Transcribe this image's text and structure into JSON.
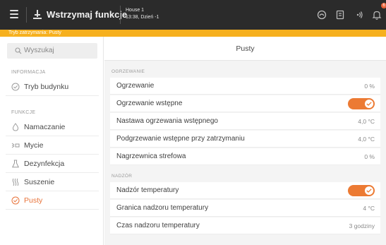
{
  "topbar": {
    "title": "Wstrzymaj funkcje",
    "house_name": "House 1",
    "house_status": "13:38, Dzień -1",
    "notification_count": "6"
  },
  "status_bar": {
    "text": "Tryb zatrzymania: Pusty"
  },
  "sidebar": {
    "search_placeholder": "Wyszukaj",
    "section_info": "INFORMACJA",
    "section_functions": "FUNKCJE",
    "items": [
      {
        "label": "Tryb budynku",
        "icon": "check-circle-icon"
      },
      {
        "label": "Namaczanie",
        "icon": "droplet-icon"
      },
      {
        "label": "Mycie",
        "icon": "spray-icon"
      },
      {
        "label": "Dezynfekcja",
        "icon": "flask-icon"
      },
      {
        "label": "Suszenie",
        "icon": "waves-icon"
      },
      {
        "label": "Pusty",
        "icon": "check-circle-icon",
        "active": true
      }
    ]
  },
  "main": {
    "header": "Pusty",
    "group_heating": "OGRZEWANIE",
    "heating_rows": [
      {
        "label": "Ogrzewanie",
        "value": "0 %"
      },
      {
        "label": "Ogrzewanie wstępne",
        "toggle": true
      },
      {
        "label": "Nastawa ogrzewania wstępnego",
        "value": "4,0 °C"
      },
      {
        "label": "Podgrzewanie wstępne przy zatrzymaniu",
        "value": "4,0 °C"
      },
      {
        "label": "Nagrzewnica strefowa",
        "value": "0 %"
      }
    ],
    "group_supervision": "NADZÓR",
    "supervision_rows": [
      {
        "label": "Nadzór temperatury",
        "toggle": true
      },
      {
        "label": "Granica nadzoru temperatury",
        "value": "4 °C"
      },
      {
        "label": "Czas nadzoru temperatury",
        "value": "3 godziny"
      }
    ]
  },
  "colors": {
    "accent": "#ec7a33",
    "warning_stripe": "#f6b01e",
    "topbar": "#2b2b2b"
  }
}
